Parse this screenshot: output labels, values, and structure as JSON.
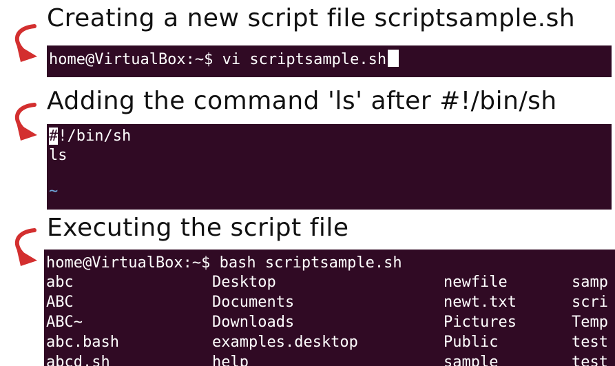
{
  "captions": {
    "step1": "Creating a new script file scriptsample.sh",
    "step2": "Adding the command 'ls' after #!/bin/sh",
    "step3": "Executing the script file"
  },
  "terminal1": {
    "prompt": "home@VirtualBox:~$",
    "command": "vi scriptsample.sh"
  },
  "terminal2": {
    "shebang_hash": "#",
    "shebang_rest": "!/bin/sh",
    "line2": "ls",
    "tilde": "~"
  },
  "terminal3": {
    "prompt": "home@VirtualBox:~$",
    "command": "bash scriptsample.sh",
    "rows": [
      [
        "abc",
        "Desktop",
        "newfile",
        "samp"
      ],
      [
        "ABC",
        "Documents",
        "newt.txt",
        "scri"
      ],
      [
        "ABC~",
        "Downloads",
        "Pictures",
        "Temp"
      ],
      [
        "abc.bash",
        "examples.desktop",
        "Public",
        "test"
      ],
      [
        "abcd.sh",
        "help",
        "sample",
        "test"
      ]
    ]
  },
  "colors": {
    "terminal_bg": "#300a24",
    "arrow": "#d32f2f",
    "tilde": "#6fa8dc"
  },
  "icons": [
    "curved-arrow-icon"
  ]
}
